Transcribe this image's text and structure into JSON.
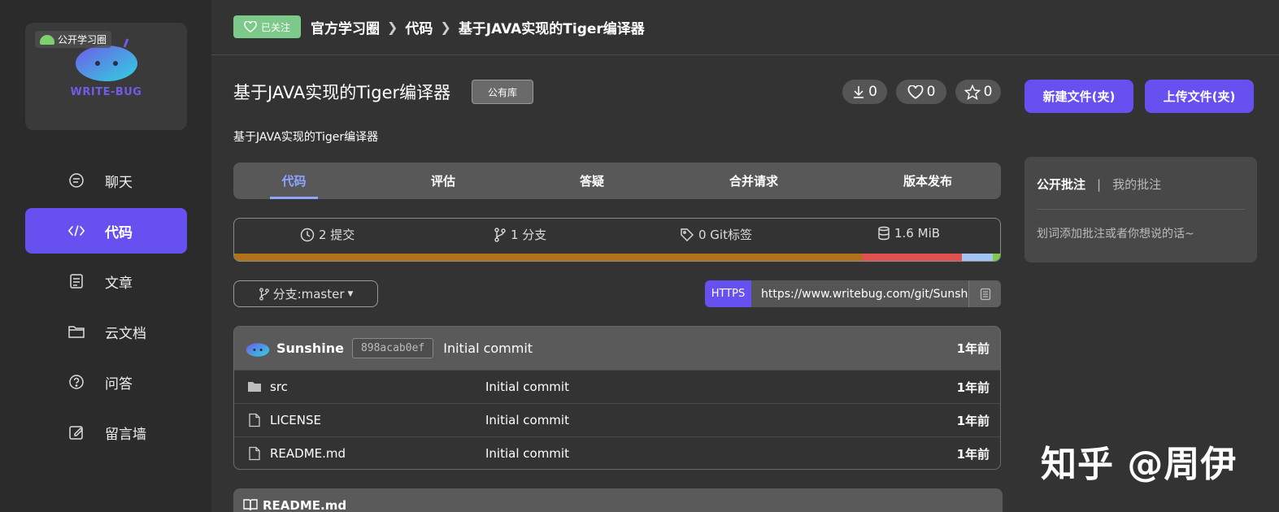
{
  "sidebar": {
    "circle_badge": "公开学习圈",
    "brand": "WRITE-BUG",
    "items": [
      {
        "label": "聊天",
        "icon": "chat-icon"
      },
      {
        "label": "代码",
        "icon": "code-icon"
      },
      {
        "label": "文章",
        "icon": "article-icon"
      },
      {
        "label": "云文档",
        "icon": "folder-icon"
      },
      {
        "label": "问答",
        "icon": "question-icon"
      },
      {
        "label": "留言墙",
        "icon": "edit-icon"
      }
    ],
    "active_index": 1
  },
  "header": {
    "follow_label": "已关注",
    "breadcrumb": [
      "官方学习圈",
      "代码",
      "基于JAVA实现的Tiger编译器"
    ]
  },
  "repo": {
    "title": "基于JAVA实现的Tiger编译器",
    "visibility": "公有库",
    "description": "基于JAVA实现的Tiger编译器",
    "downloads": "0",
    "likes": "0",
    "stars": "0"
  },
  "actions": {
    "new_file": "新建文件(夹)",
    "upload_file": "上传文件(夹)"
  },
  "tabs": [
    "代码",
    "评估",
    "答疑",
    "合并请求",
    "版本发布"
  ],
  "stats": {
    "commits": "2 提交",
    "branches": "1 分支",
    "tags": "0 Git标签",
    "size": "1.6 MiB"
  },
  "languages": [
    {
      "share": 0.82,
      "color": "#b07219"
    },
    {
      "share": 0.13,
      "color": "#e05252"
    },
    {
      "share": 0.04,
      "color": "#a3c4f3"
    },
    {
      "share": 0.01,
      "color": "#7ec84a"
    }
  ],
  "branch": {
    "label": "分支:master"
  },
  "clone": {
    "protocol": "HTTPS",
    "url": "https://www.writebug.com/git/Sunsh"
  },
  "latest_commit": {
    "author": "Sunshine",
    "hash": "898acab0ef",
    "message": "Initial commit",
    "time": "1年前"
  },
  "files": [
    {
      "name": "src",
      "type": "folder",
      "message": "Initial commit",
      "time": "1年前"
    },
    {
      "name": "LICENSE",
      "type": "file",
      "message": "Initial commit",
      "time": "1年前"
    },
    {
      "name": "README.md",
      "type": "file",
      "message": "Initial commit",
      "time": "1年前"
    }
  ],
  "readme": {
    "title": "README.md"
  },
  "annotations": {
    "tab_public": "公开批注",
    "separator": "|",
    "tab_mine": "我的批注",
    "hint": "划词添加批注或者你想说的话~"
  },
  "watermark": "知乎 @周伊"
}
